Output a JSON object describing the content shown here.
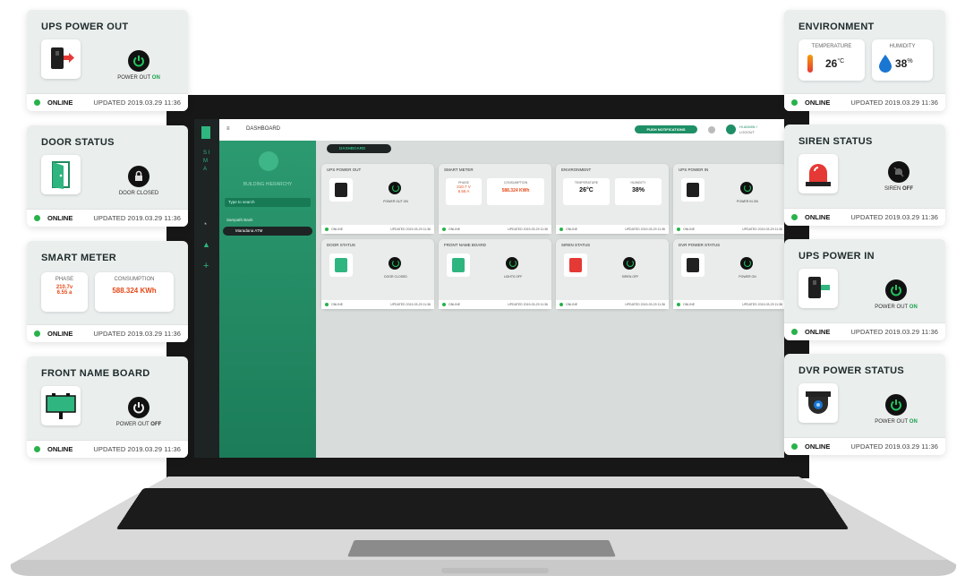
{
  "cards": {
    "ups_out": {
      "title": "UPS POWER OUT",
      "status_prefix": "POWER OUT",
      "status_value": "ON",
      "online": "ONLINE",
      "updated": "UPDATED 2019.03.29 11:36"
    },
    "door": {
      "title": "DOOR STATUS",
      "status": "DOOR CLOSED",
      "online": "ONLINE",
      "updated": "UPDATED 2019.03.29 11:36"
    },
    "meter": {
      "title": "SMART METER",
      "phase_label": "PHASE",
      "phase_v": "210.7v",
      "phase_a": "6.55 a",
      "consumption_label": "CONSUMPTION",
      "consumption_value": "588.324 KWh",
      "online": "ONLINE",
      "updated": "UPDATED 2019.03.29 11:36"
    },
    "front": {
      "title": "FRONT NAME BOARD",
      "status_prefix": "POWER OUT",
      "status_value": "OFF",
      "online": "ONLINE",
      "updated": "UPDATED 2019.03.29 11:36"
    },
    "env": {
      "title": "ENVIRONMENT",
      "temp_label": "TEMPERATURE",
      "temp_value": "26",
      "temp_unit": "°C",
      "hum_label": "HUMIDITY",
      "hum_value": "38",
      "hum_unit": "%",
      "online": "ONLINE",
      "updated": "UPDATED 2019.03.29 11:36"
    },
    "siren": {
      "title": "SIREN STATUS",
      "status_prefix": "SIREN",
      "status_value": "OFF",
      "online": "ONLINE",
      "updated": "UPDATED 2019.03.29 11:36"
    },
    "ups_in": {
      "title": "UPS POWER IN",
      "status_prefix": "POWER OUT",
      "status_value": "ON",
      "online": "ONLINE",
      "updated": "UPDATED 2019.03.29 11:36"
    },
    "dvr": {
      "title": "DVR POWER STATUS",
      "status_prefix": "POWER OUT",
      "status_value": "ON",
      "online": "ONLINE",
      "updated": "UPDATED 2019.03.29 11:36"
    }
  },
  "screen": {
    "top_title": "DASHBOARD",
    "push_button": "PUSH NOTIFICATIONS",
    "user_greeting": "Hi ADMIN !",
    "logout": "LOGOUT",
    "rail_letters": "S I M A",
    "side_title": "BUILDING HIERARCHY",
    "search_placeholder": "Type to search",
    "tree_root": "Sampath Bank",
    "tree_child": "Maradana ATM",
    "tab": "DASHBOARD",
    "tiles": [
      {
        "title": "UPS POWER OUT",
        "label": "POWER OUT ON"
      },
      {
        "title": "SMART METER",
        "label": ""
      },
      {
        "title": "ENVIRONMENT",
        "label": ""
      },
      {
        "title": "UPS POWER IN",
        "label": "POWER IN ON"
      },
      {
        "title": "DOOR STATUS",
        "label": "DOOR CLOSED"
      },
      {
        "title": "FRONT NAME BOARD",
        "label": "LIGHTS OFF"
      },
      {
        "title": "SIREN STATUS",
        "label": "SIREN OFF"
      },
      {
        "title": "DVR POWER STATUS",
        "label": "POWER ON"
      }
    ],
    "tile_online": "ONLINE",
    "tile_updated": "UPDATED 2019-03-29 11:36",
    "meter_phase": "PHASE",
    "meter_v": "210.7 V",
    "meter_a": "6.55 A",
    "meter_cons_label": "CONSUMPTION",
    "meter_cons": "588.324 KWh",
    "env_temp_label": "TEMPERATURE",
    "env_temp": "26°C",
    "env_hum_label": "HUMIDITY",
    "env_hum": "38%"
  },
  "colors": {
    "accent": "#1e8f66",
    "online": "#27b24a",
    "power_on": "#22c55e",
    "alert_red": "#e53935"
  }
}
